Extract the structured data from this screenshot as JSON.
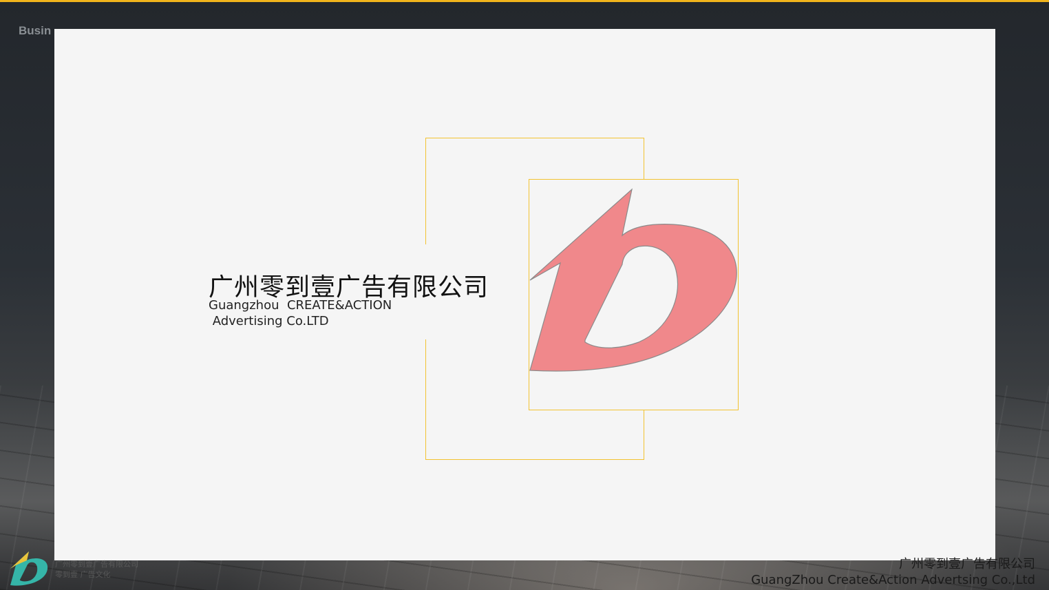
{
  "background": {
    "title": "Busin",
    "accent_color": "#f0b41c"
  },
  "slide": {
    "company_cn": "广州零到壹广告有限公司",
    "company_en_line1": "Guangzhou  CREATE&ACTION",
    "company_en_line2": " Advertising Co.LTD",
    "logo_icon": "zero-to-one-logo-icon",
    "logo_color": "#f0888b",
    "frame_color": "#f2c230"
  },
  "footer": {
    "logo_icon": "zero-to-one-logo-icon",
    "logo_text_line1": "广州零到壹广告有限公司",
    "logo_text_line2": "零到壹 广告文化",
    "company_cn": "广州零到壹广告有限公司",
    "company_en": "GuangZhou Create&Action Advertsing Co.,Ltd"
  }
}
